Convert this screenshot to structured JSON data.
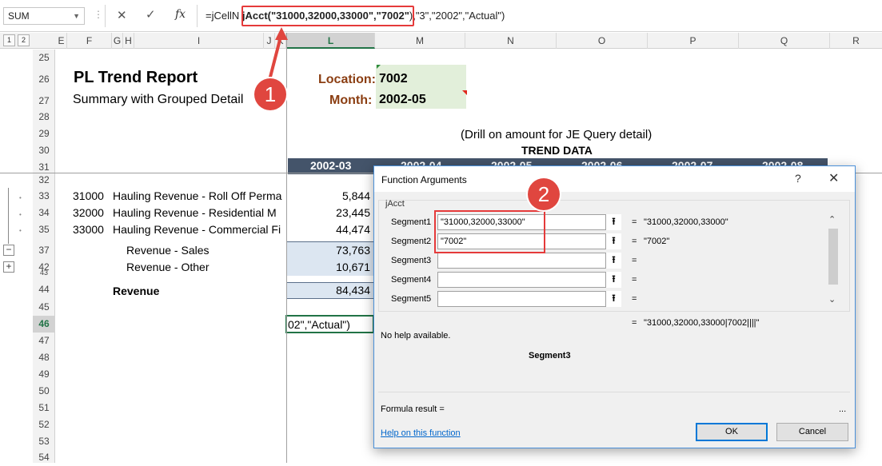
{
  "formula_bar": {
    "namebox": "SUM",
    "dots": "⋮",
    "cancel_icon": "✕",
    "enter_icon": "✓",
    "fx": "fx",
    "formula_prefix": "=jCellN",
    "formula_highlight": "jAcct(\"31000,32000,33000\",\"7002\"",
    "formula_suffix": "),\"3\",\"2002\",\"Actual\")"
  },
  "outline_levels": [
    "1",
    "2"
  ],
  "columns": [
    "E",
    "F",
    "G",
    "H",
    "I",
    "J",
    "K",
    "L",
    "M",
    "N",
    "O",
    "P",
    "Q",
    "R"
  ],
  "active_column": "L",
  "rows": [
    "25",
    "26",
    "27",
    "28",
    "29",
    "30",
    "31",
    "32",
    "33",
    "34",
    "35",
    "37",
    "42",
    "43",
    "44",
    "45",
    "46",
    "47",
    "48",
    "49",
    "50",
    "51",
    "52",
    "53",
    "54"
  ],
  "active_row": "46",
  "outline": {
    "minus": "−",
    "plus": "+"
  },
  "report": {
    "title": "PL Trend Report",
    "subtitle": "Summary with Grouped Detail",
    "location_label": "Location:",
    "location_value": "7002",
    "month_label": "Month:",
    "month_value": "2002-05",
    "drill_note": "(Drill on amount for JE Query detail)",
    "trend_header": "TREND DATA",
    "periods": [
      "2002-03",
      "2002-04",
      "2002-05",
      "2002-06",
      "2002-07",
      "2002-08"
    ]
  },
  "detail_rows": [
    {
      "acct": "31000",
      "desc": "Hauling Revenue - Roll Off Perma",
      "value": "5,844"
    },
    {
      "acct": "32000",
      "desc": "Hauling Revenue - Residential M",
      "value": "23,445"
    },
    {
      "acct": "33000",
      "desc": "Hauling Revenue - Commercial Fi",
      "value": "44,474"
    }
  ],
  "summary_rows": [
    {
      "desc": "Revenue - Sales",
      "value": "73,763"
    },
    {
      "desc": "Revenue - Other",
      "value": "10,671"
    }
  ],
  "total_row": {
    "desc": "Revenue",
    "value": "84,434"
  },
  "editing_cell": "02\",\"Actual\")",
  "callouts": [
    "1",
    "2"
  ],
  "dialog": {
    "title": "Function Arguments",
    "help_icon": "?",
    "close_icon": "✕",
    "function_name": "jAcct",
    "args": [
      {
        "label": "Segment1",
        "value": "\"31000,32000,33000\"",
        "result": "\"31000,32000,33000\""
      },
      {
        "label": "Segment2",
        "value": "\"7002\"",
        "result": "\"7002\""
      },
      {
        "label": "Segment3",
        "value": "",
        "result": ""
      },
      {
        "label": "Segment4",
        "value": "",
        "result": ""
      },
      {
        "label": "Segment5",
        "value": "",
        "result": ""
      }
    ],
    "equals": "=",
    "ref_icon": "⭱",
    "result": "\"31000,32000,33000|7002||||\"",
    "no_help": "No help available.",
    "current_arg": "Segment3",
    "formula_result": "Formula result =",
    "ellipsis": "...",
    "help_link": "Help on this function",
    "ok_label": "OK",
    "cancel_label": "Cancel"
  }
}
